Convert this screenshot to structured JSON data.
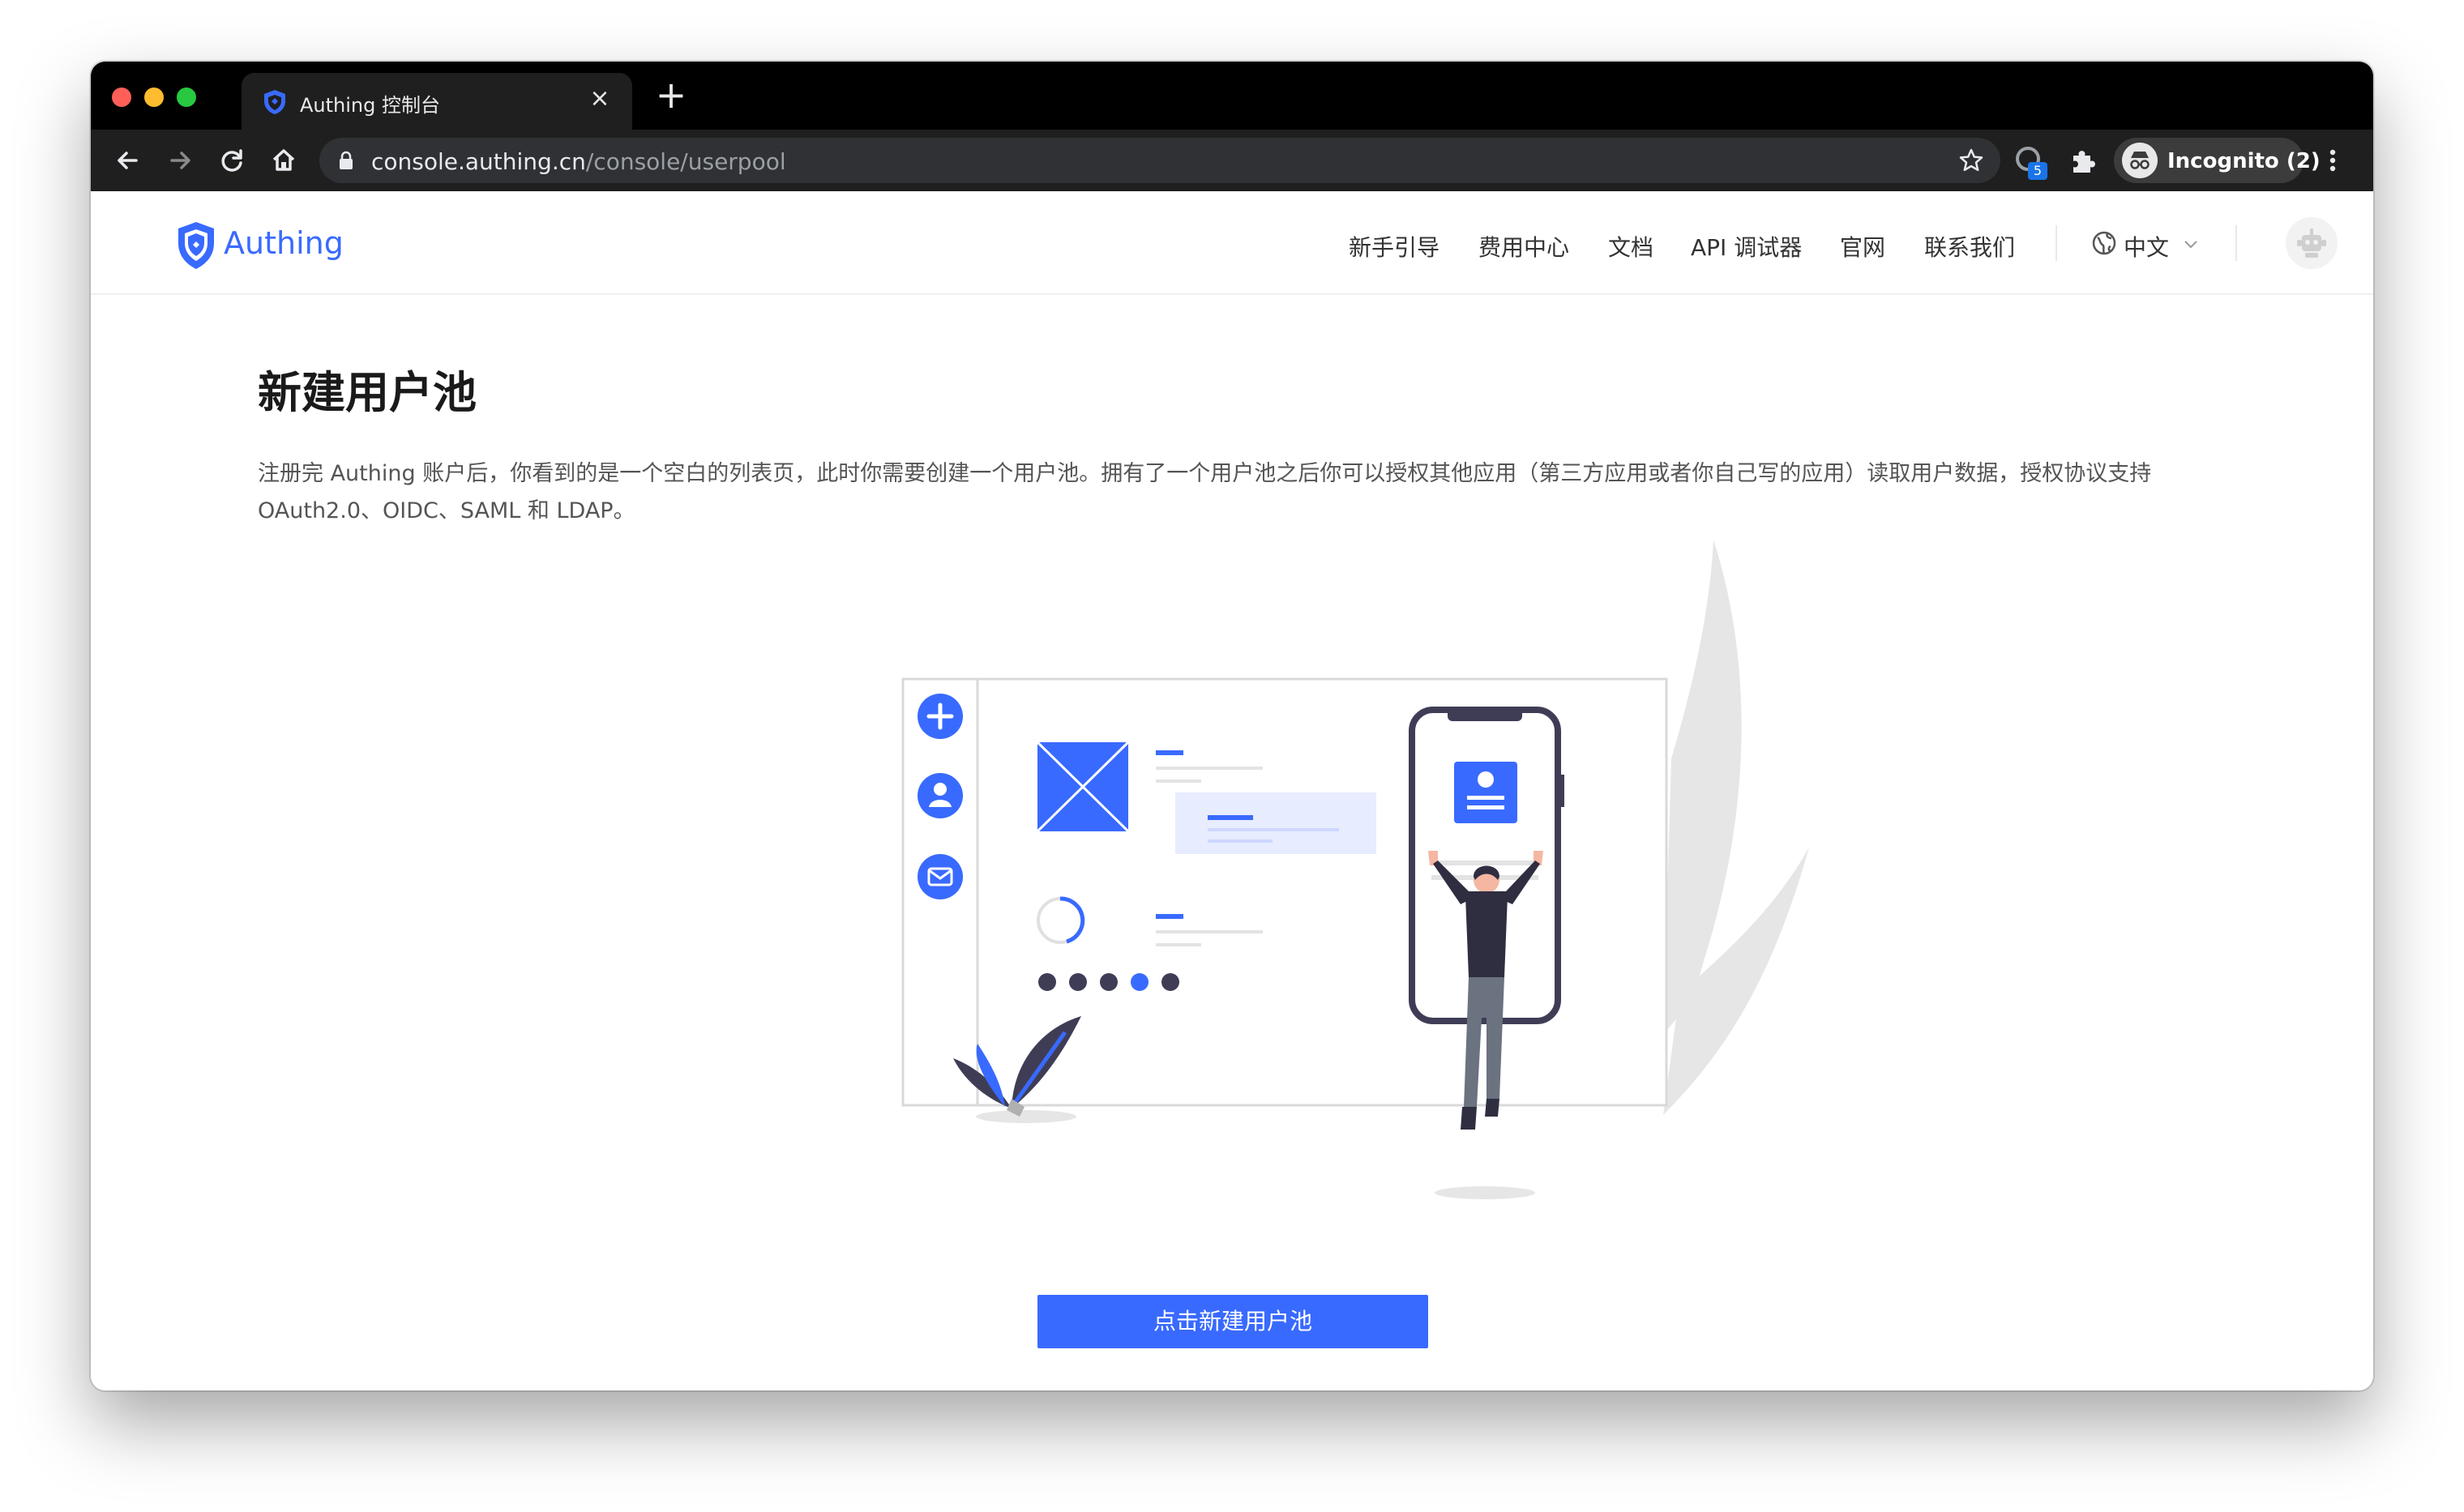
{
  "browser": {
    "tab_title": "Authing 控制台",
    "close_tab_label": "×",
    "new_tab_label": "+",
    "url_host": "console.authing.cn",
    "url_path": "/console/userpool",
    "extension_badge": "5",
    "profile_label": "Incognito (2)"
  },
  "header": {
    "logo_text": "Authing",
    "nav": [
      "新手引导",
      "费用中心",
      "文档",
      "API 调试器",
      "官网",
      "联系我们"
    ],
    "language": "中文"
  },
  "main": {
    "title": "新建用户池",
    "description": "注册完 Authing 账户后，你看到的是一个空白的列表页，此时你需要创建一个用户池。拥有了一个用户池之后你可以授权其他应用（第三方应用或者你自己写的应用）读取用户数据，授权协议支持 OAuth2.0、OIDC、SAML 和 LDAP。",
    "create_button": "点击新建用户池"
  },
  "colors": {
    "brand": "#396aff",
    "tab_bar": "#000000",
    "toolbar": "#1f1f1f",
    "traffic_red": "#ff5f57",
    "traffic_yellow": "#febc2e",
    "traffic_green": "#28c840"
  },
  "icons": [
    "shield-logo-icon",
    "back-icon",
    "forward-icon",
    "reload-icon",
    "home-icon",
    "lock-icon",
    "star-icon",
    "puzzle-icon",
    "incognito-icon",
    "menu-icon",
    "globe-icon",
    "chevron-down-icon",
    "avatar-robot-icon"
  ]
}
